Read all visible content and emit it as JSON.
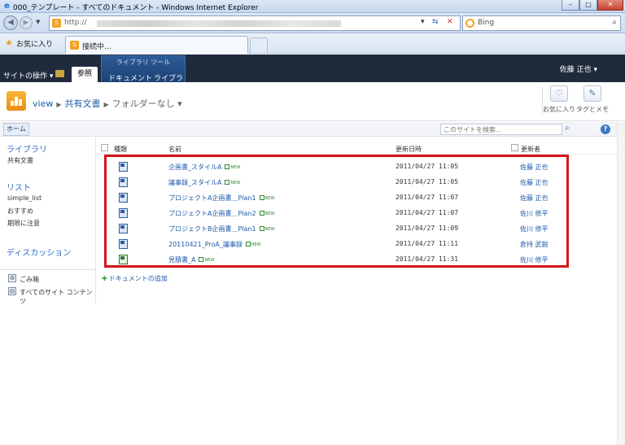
{
  "browser": {
    "window_title": "000_テンプレート - すべてのドキュメント - Windows Internet Explorer",
    "url_prefix": "http://",
    "search_engine": "Bing",
    "favorites_label": "お気に入り",
    "tab_label": "接続中...",
    "window_buttons": [
      "–",
      "□",
      "✕"
    ]
  },
  "ribbon": {
    "site_actions": "サイトの操作 ▾",
    "browse_tab": "参照",
    "tool_group": "ライブラリ ツール",
    "tool_tabs": [
      "ドキュメント",
      "ライブラリ"
    ],
    "user": "佐藤 正也 ▾"
  },
  "titlearea": {
    "breadcrumb": [
      "view",
      "共有文書",
      "フォルダーなし ▾"
    ],
    "social": [
      {
        "label": "お気に入り",
        "icon": "like-icon"
      },
      {
        "label": "タグとメモ",
        "icon": "tags-notes-icon"
      }
    ]
  },
  "navbar": {
    "home": "ホーム",
    "search_placeholder": "このサイトを検索...",
    "help": "?"
  },
  "leftnav": {
    "libraries_heading": "ライブラリ",
    "libraries": [
      "共有文書"
    ],
    "lists_heading": "リスト",
    "lists": [
      "simple_list",
      "おすすめ",
      "期限に注意"
    ],
    "discussions_heading": "ディスカッション",
    "recycle_bin": "ごみ箱",
    "all_content": "すべてのサイト コンテンツ"
  },
  "list": {
    "columns": {
      "type": "種類",
      "name": "名前",
      "modified": "更新日時",
      "editor": "更新者"
    },
    "new_label": "NEW",
    "rows": [
      {
        "icon": "word-doc-icon",
        "name": "企画書_スタイルA",
        "modified": "2011/04/27 11:05",
        "editor": "佐藤 正也"
      },
      {
        "icon": "word-doc-icon",
        "name": "議事録_スタイルA",
        "modified": "2011/04/27 11:05",
        "editor": "佐藤 正也"
      },
      {
        "icon": "word-doc-icon",
        "name": "プロジェクトA企画書＿Plan1",
        "modified": "2011/04/27 11:07",
        "editor": "佐藤 正也"
      },
      {
        "icon": "word-doc-icon",
        "name": "プロジェクトA企画書＿Plan2",
        "modified": "2011/04/27 11:07",
        "editor": "佐川 修平"
      },
      {
        "icon": "word-doc-icon",
        "name": "プロジェクトB企画書＿Plan1",
        "modified": "2011/04/27 11:09",
        "editor": "佐川 修平"
      },
      {
        "icon": "word-doc-icon",
        "name": "20110421_ProA_議事録",
        "modified": "2011/04/27 11:11",
        "editor": "倉持 武鋭"
      },
      {
        "icon": "excel-doc-icon",
        "name": "見積書_A",
        "modified": "2011/04/27 11:31",
        "editor": "佐川 修平"
      }
    ],
    "add_document": "ドキュメントの追加"
  },
  "colors": {
    "ribbon": "#1f2b3d",
    "link": "#1d5aa8",
    "highlight": "#d4151a"
  }
}
